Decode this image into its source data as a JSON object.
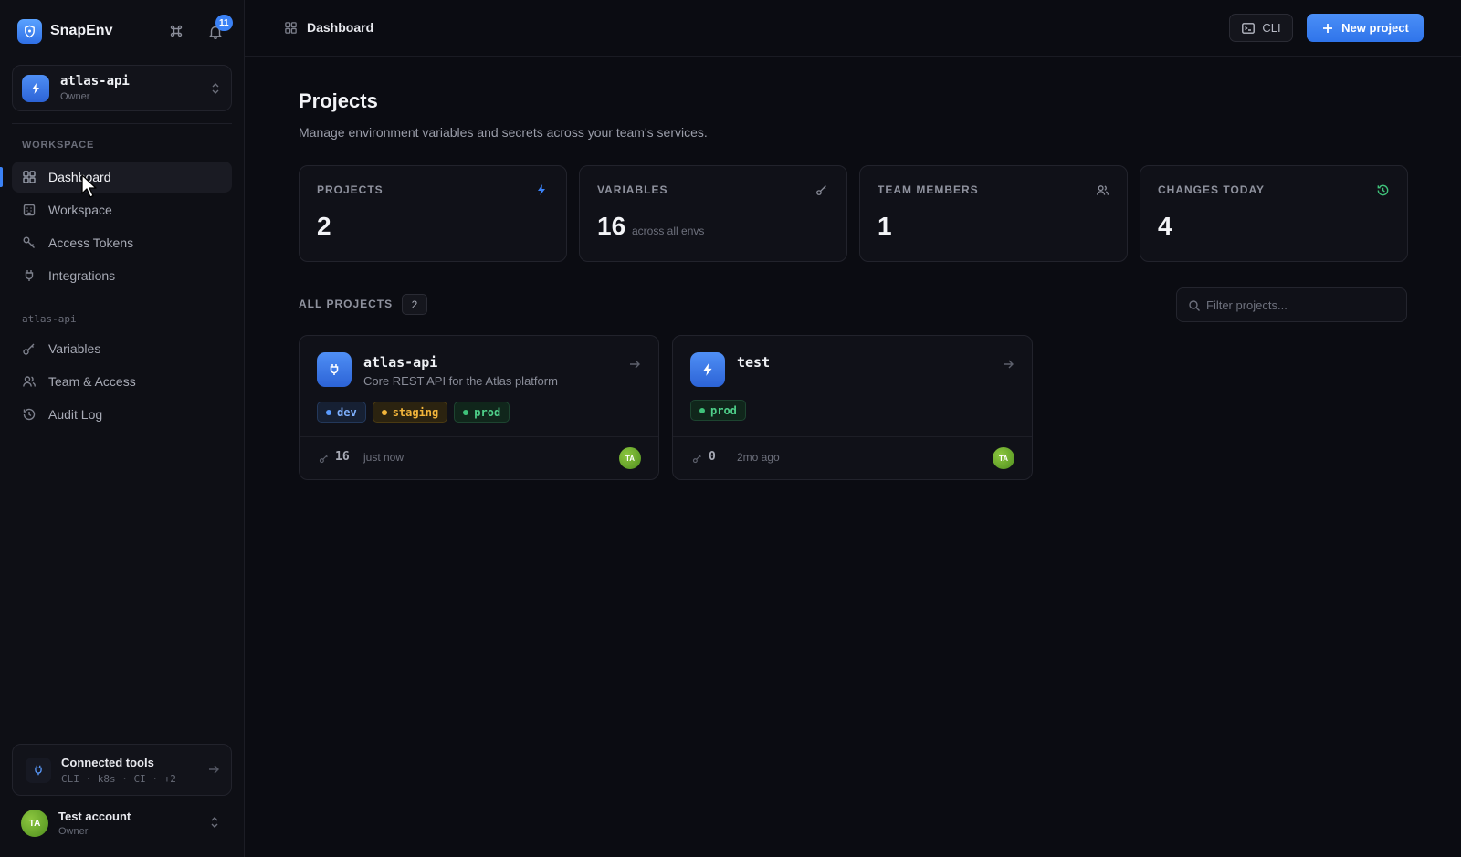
{
  "app": {
    "name": "SnapEnv",
    "notification_count": "11"
  },
  "project_switcher": {
    "name": "atlas-api",
    "role": "Owner"
  },
  "sidebar": {
    "workspace_label": "WORKSPACE",
    "workspace_items": [
      {
        "label": "Dashboard",
        "icon": "grid-icon",
        "active": true
      },
      {
        "label": "Workspace",
        "icon": "building-icon"
      },
      {
        "label": "Access Tokens",
        "icon": "key-icon"
      },
      {
        "label": "Integrations",
        "icon": "plug-icon"
      }
    ],
    "project_label": "atlas-api",
    "project_items": [
      {
        "label": "Variables",
        "icon": "key-icon"
      },
      {
        "label": "Team & Access",
        "icon": "users-icon"
      },
      {
        "label": "Audit Log",
        "icon": "history-icon"
      }
    ]
  },
  "connected_tools": {
    "title": "Connected tools",
    "subtitle": "CLI · k8s · CI · +2"
  },
  "account": {
    "name": "Test account",
    "role": "Owner",
    "initials": "TA"
  },
  "topbar": {
    "breadcrumb": "Dashboard",
    "cli_label": "CLI",
    "new_project_label": "New project"
  },
  "main": {
    "title": "Projects",
    "subtitle": "Manage environment variables and secrets across your team's services."
  },
  "stats": [
    {
      "label": "PROJECTS",
      "value": "2",
      "icon": "bolt-icon",
      "color": "#3b82f6"
    },
    {
      "label": "VARIABLES",
      "value": "16",
      "suffix": "across all envs",
      "icon": "key-icon",
      "color": "#8a8d99"
    },
    {
      "label": "TEAM MEMBERS",
      "value": "1",
      "icon": "users-icon",
      "color": "#8a8d99"
    },
    {
      "label": "CHANGES TODAY",
      "value": "4",
      "icon": "history-icon",
      "color": "#3fc27a"
    }
  ],
  "projects_section": {
    "label": "ALL PROJECTS",
    "count": "2",
    "filter_placeholder": "Filter projects..."
  },
  "projects": [
    {
      "name": "atlas-api",
      "description": "Core REST API for the Atlas platform",
      "icon": "plug-icon",
      "envs": [
        "dev",
        "staging",
        "prod"
      ],
      "var_count": "16",
      "updated": "just now",
      "owner_initials": "TA"
    },
    {
      "name": "test",
      "description": "",
      "icon": "bolt-icon",
      "envs": [
        "prod"
      ],
      "var_count": "0",
      "updated": "2mo ago",
      "owner_initials": "TA"
    }
  ]
}
